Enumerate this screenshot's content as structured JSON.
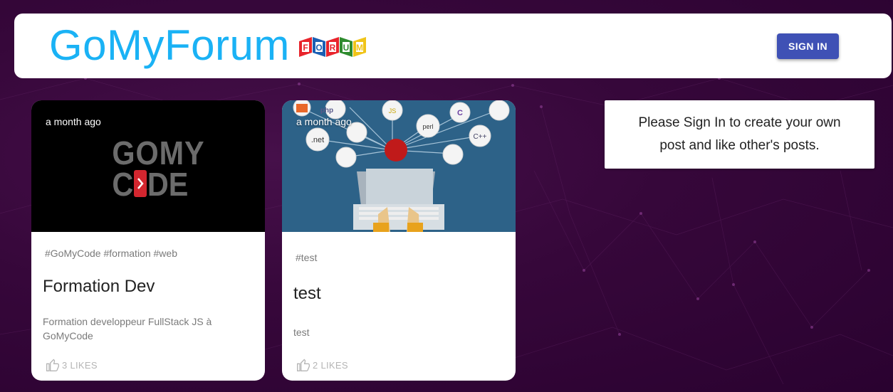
{
  "header": {
    "brand": "GoMyForum",
    "logo_letters": [
      "F",
      "O",
      "R",
      "U",
      "M"
    ],
    "logo_colors": [
      "#e8242c",
      "#1a5fb4",
      "#e8242c",
      "#2e8b2e",
      "#f0c419"
    ],
    "signin_label": "SIGN IN",
    "brand_color": "#1ab2f5",
    "button_color": "#3f51b5"
  },
  "posts": [
    {
      "time": "a month ago",
      "image": "gomycode-logo",
      "image_text": [
        "GOMY",
        "C",
        "DE",
        "."
      ],
      "tags": "#GoMyCode #formation #web",
      "title": "Formation Dev",
      "description": "Formation developpeur FullStack JS à GoMyCode",
      "likes": "3 LIKES"
    },
    {
      "time": "a month ago",
      "image": "programming-languages-laptop",
      "image_text": [
        "php",
        ".net",
        "perl",
        "C++",
        "JS",
        "C"
      ],
      "tags": "#test",
      "title": "test",
      "description": "test",
      "likes": "2 LIKES"
    }
  ],
  "sidebar": {
    "message": "Please Sign In to create your own post and like other's posts."
  }
}
